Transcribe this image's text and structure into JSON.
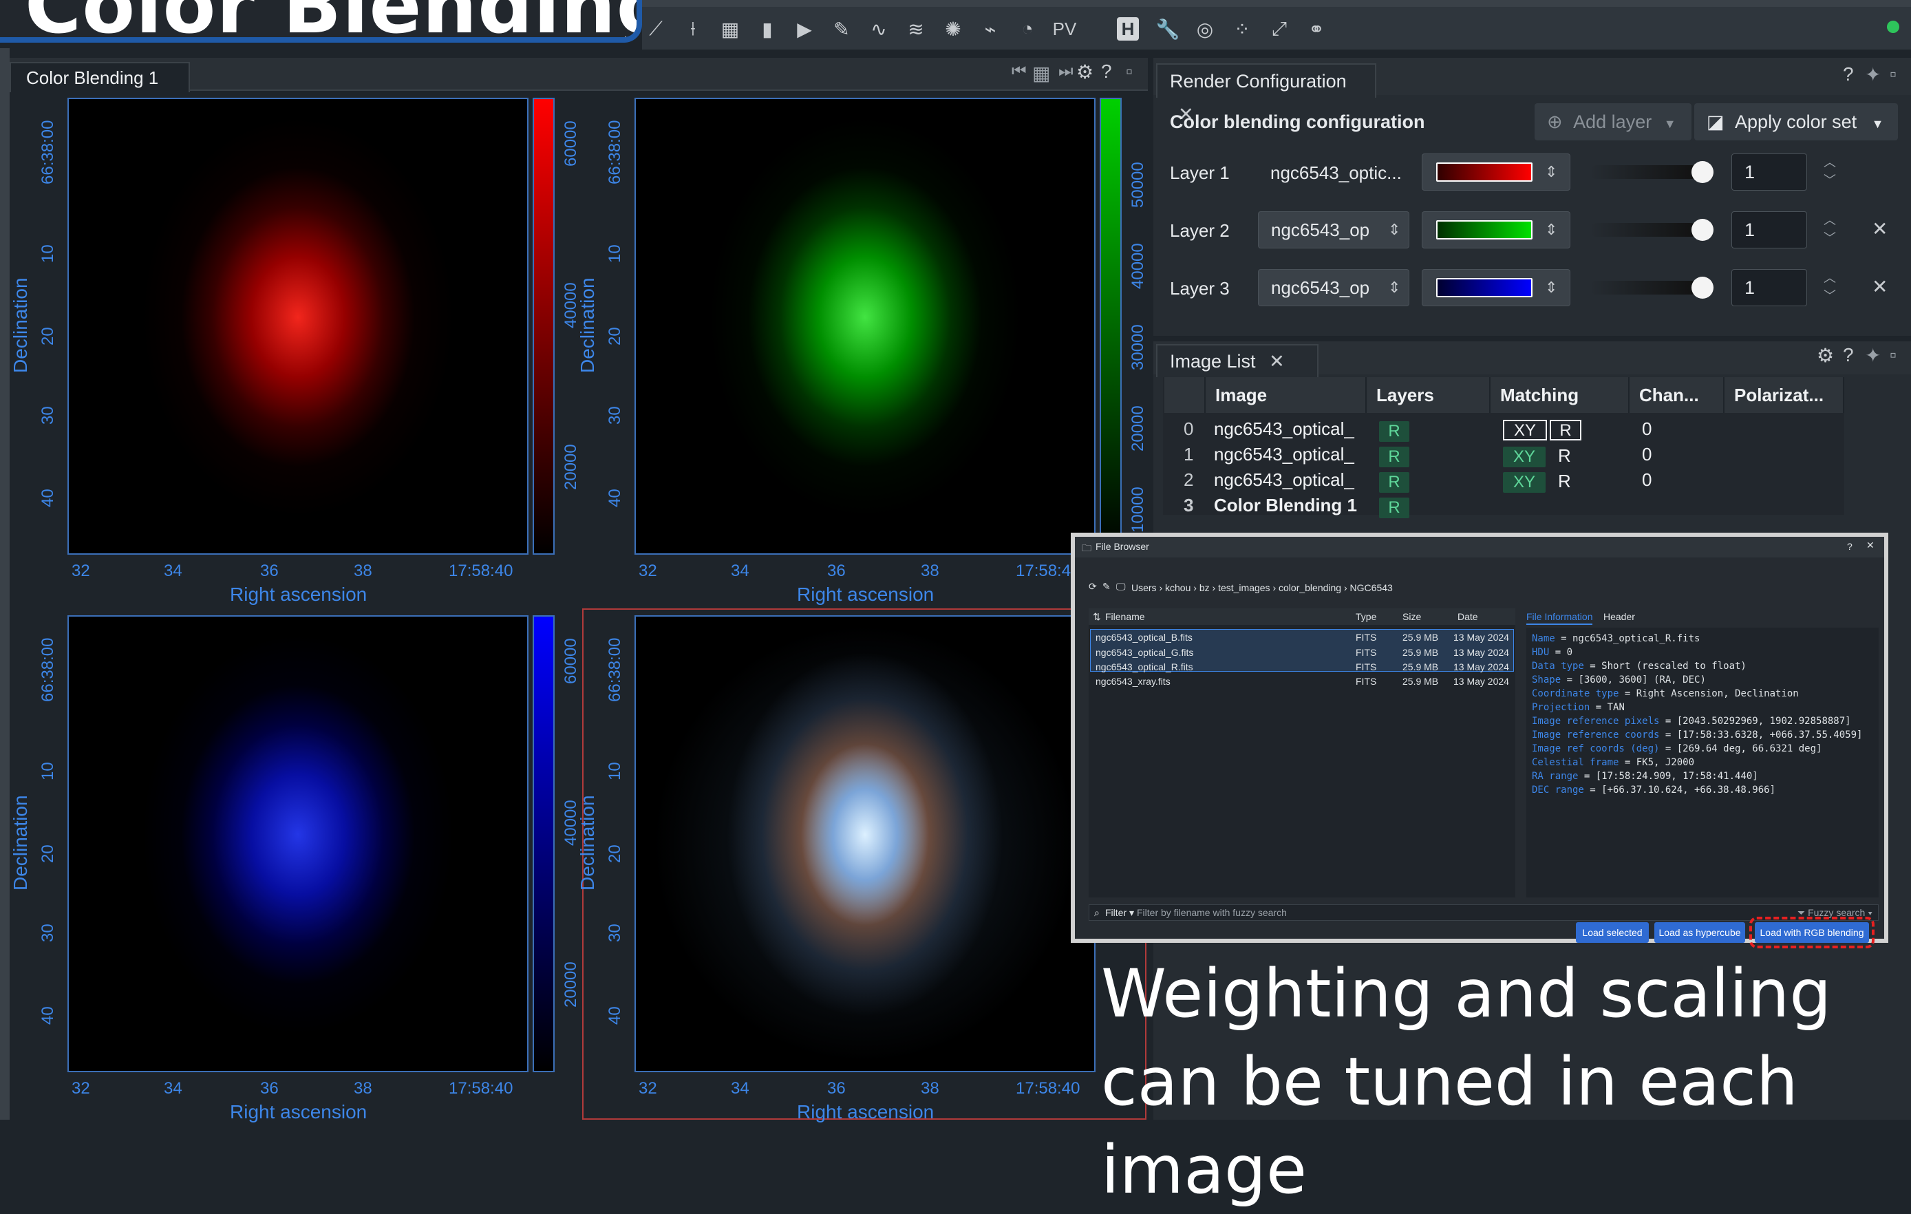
{
  "banner": {
    "title": "Color Blending"
  },
  "toolbar": {
    "icons": [
      "xy-profile-icon",
      "z-profile-icon",
      "calculator-icon",
      "histogram-icon",
      "animator-icon",
      "annotation-icon",
      "spectral-icon",
      "layers-icon",
      "catalog-icon",
      "fitting-icon",
      "moment-icon"
    ],
    "pv_label": "PV",
    "h_label": "H"
  },
  "image_panel": {
    "tab_label": "Color Blending 1",
    "axis_x_title": "Right ascension",
    "axis_y_title": "Declination",
    "x_ticks": [
      "32",
      "34",
      "36",
      "38",
      "17:58:40"
    ],
    "y_ticks": [
      "66:38:00",
      "10",
      "20",
      "30",
      "40"
    ],
    "colorbar_ticks": {
      "red": [
        "60000",
        "40000",
        "20000"
      ],
      "green": [
        "50000",
        "40000",
        "30000",
        "20000",
        "10000"
      ],
      "blue": [
        "60000",
        "40000",
        "20000"
      ]
    },
    "colors": {
      "red": "#ff0000",
      "green": "#00d000",
      "blue": "#0000ff"
    }
  },
  "render_config": {
    "tab_label": "Render Configuration",
    "heading": "Color blending configuration",
    "add_layer_label": "Add layer",
    "apply_color_set_label": "Apply color set",
    "layers": [
      {
        "label": "Layer 1",
        "image": "ngc6543_optic...",
        "alpha": "1"
      },
      {
        "label": "Layer 2",
        "image": "ngc6543_op",
        "alpha": "1"
      },
      {
        "label": "Layer 3",
        "image": "ngc6543_op",
        "alpha": "1"
      }
    ]
  },
  "image_list": {
    "tab_label": "Image List",
    "headers": [
      "Image",
      "Layers",
      "Matching",
      "Chan...",
      "Polarizat..."
    ],
    "rows": [
      {
        "index": "0",
        "image": "ngc6543_optical_",
        "layers": "R",
        "channel": "0"
      },
      {
        "index": "1",
        "image": "ngc6543_optical_",
        "layers": "R",
        "channel": "0"
      },
      {
        "index": "2",
        "image": "ngc6543_optical_",
        "layers": "R",
        "channel": "0"
      },
      {
        "index": "3",
        "image": "Color Blending 1",
        "layers": "R",
        "channel": ""
      }
    ],
    "match_xy": "XY",
    "match_r": "R"
  },
  "file_browser": {
    "title": "File Browser",
    "breadcrumb": [
      "Users",
      "kchou",
      "bz",
      "test_images",
      "color_blending",
      "NGC6543"
    ],
    "columns": [
      "Filename",
      "Type",
      "Size",
      "Date"
    ],
    "files": [
      {
        "name": "ngc6543_optical_B.fits",
        "type": "FITS",
        "size": "25.9 MB",
        "date": "13 May 2024"
      },
      {
        "name": "ngc6543_optical_G.fits",
        "type": "FITS",
        "size": "25.9 MB",
        "date": "13 May 2024"
      },
      {
        "name": "ngc6543_optical_R.fits",
        "type": "FITS",
        "size": "25.9 MB",
        "date": "13 May 2024"
      },
      {
        "name": "ngc6543_xray.fits",
        "type": "FITS",
        "size": "25.9 MB",
        "date": "13 May 2024"
      }
    ],
    "info_tabs": [
      "File Information",
      "Header"
    ],
    "info": [
      {
        "key": "Name",
        "value": " = ngc6543_optical_R.fits"
      },
      {
        "key": "HDU",
        "value": " = 0"
      },
      {
        "key": "Data type",
        "value": " = Short (rescaled to float)"
      },
      {
        "key": "Shape",
        "value": " = [3600, 3600] (RA, DEC)"
      },
      {
        "key": "Coordinate type",
        "value": " = Right Ascension, Declination"
      },
      {
        "key": "Projection",
        "value": " = TAN"
      },
      {
        "key": "Image reference pixels",
        "value": " = [2043.50292969, 1902.92858887]"
      },
      {
        "key": "Image reference coords",
        "value": " = [17:58:33.6328, +066.37.55.4059]"
      },
      {
        "key": "Image ref coords (deg)",
        "value": " = [269.64 deg, 66.6321 deg]"
      },
      {
        "key": "Celestial frame",
        "value": " = FK5, J2000"
      },
      {
        "key": "RA range",
        "value": " = [17:58:24.909, 17:58:41.440]"
      },
      {
        "key": "DEC range",
        "value": " = [+66.37.10.624, +66.38.48.966]"
      }
    ],
    "filter_label": "Filter",
    "filter_placeholder": "Filter by filename with fuzzy search",
    "fuzzy_label": "Fuzzy search",
    "buttons": {
      "load_selected": "Load selected",
      "load_hypercube": "Load as hypercube",
      "load_rgb": "Load with RGB blending"
    }
  },
  "caption": "Weighting and scaling can be tuned in each image"
}
